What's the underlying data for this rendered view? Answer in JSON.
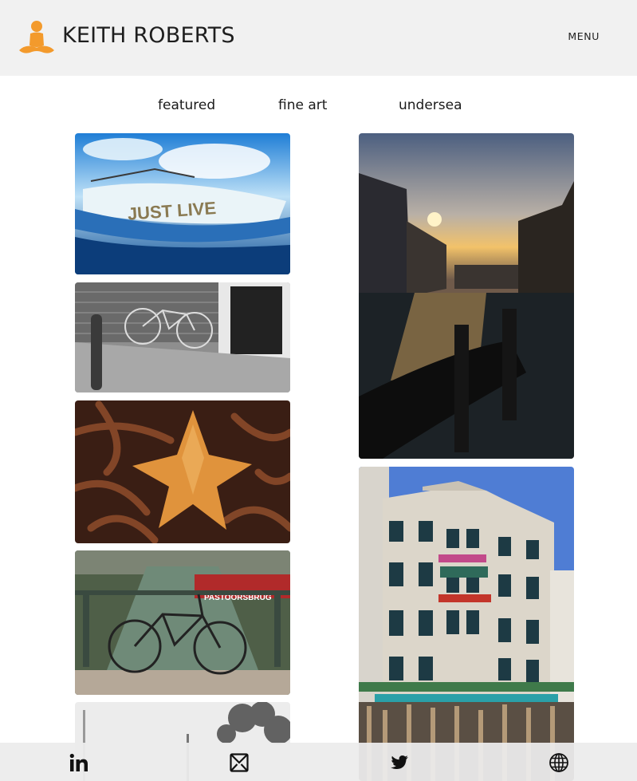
{
  "header": {
    "brand": "KEITH ROBERTS",
    "menu_label": "MENU",
    "logo_icon": "meditating-figure-icon",
    "accent_color": "#f39a2c"
  },
  "categories": [
    {
      "label": "featured"
    },
    {
      "label": "fine art"
    },
    {
      "label": "undersea"
    }
  ],
  "gallery": [
    {
      "subject": "boat-reflection",
      "painted_text": "JUST LIVE"
    },
    {
      "subject": "bicycle-brick-wall"
    },
    {
      "subject": "starfish-on-coral"
    },
    {
      "subject": "bicycle-canal",
      "painted_text": "PASTOORSBRUG"
    },
    {
      "subject": "misty-trees"
    },
    {
      "subject": "canal-sunset-gondola"
    },
    {
      "subject": "venetian-building"
    }
  ],
  "footer": {
    "icons": [
      "linkedin-icon",
      "mail-icon",
      "twitter-icon",
      "globe-icon"
    ]
  }
}
